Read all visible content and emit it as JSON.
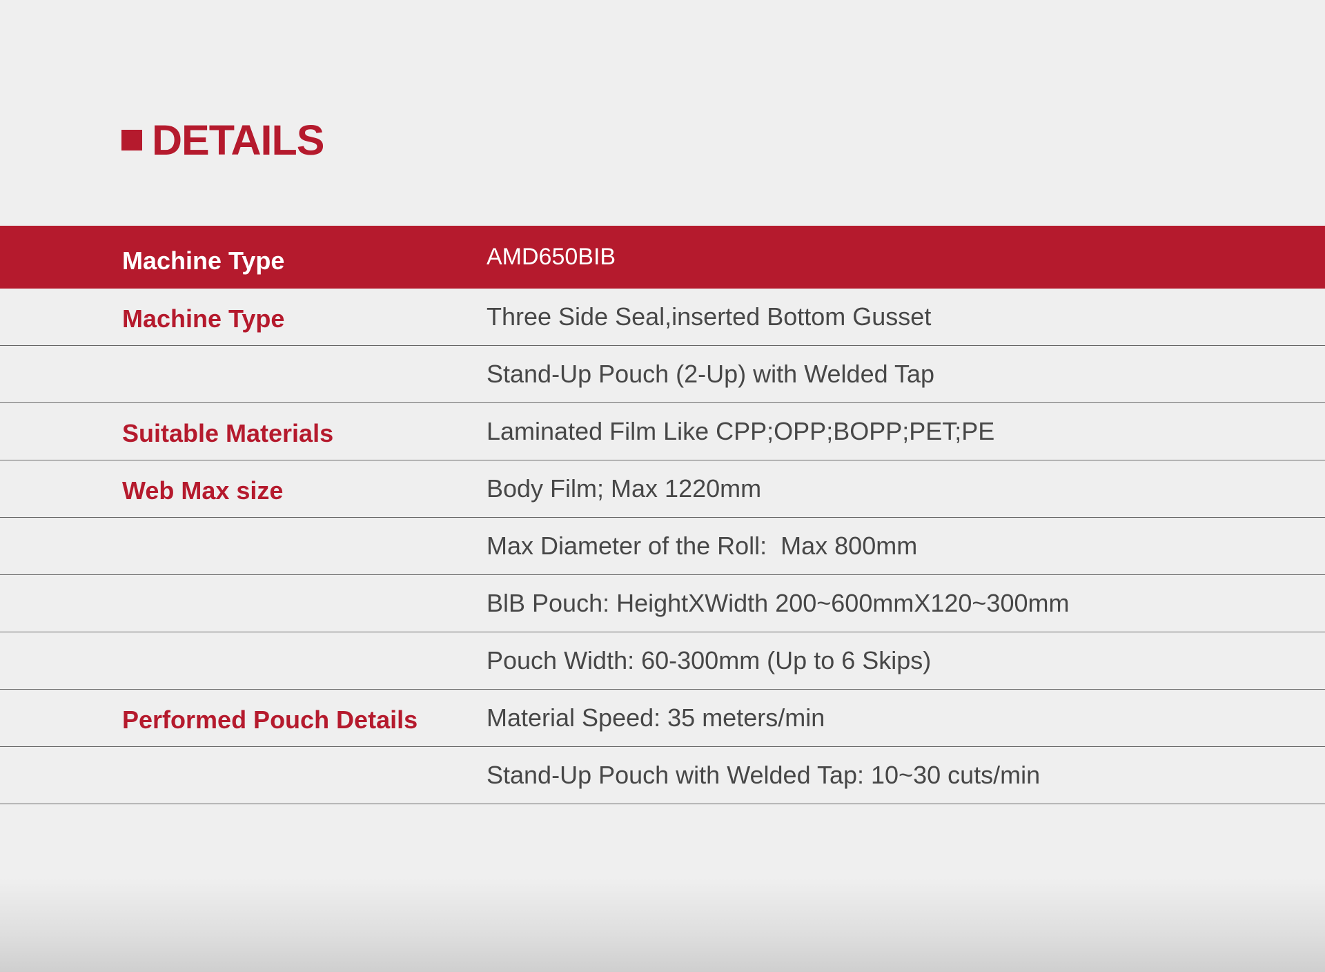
{
  "heading": {
    "title": "DETAILS"
  },
  "specs": {
    "header": {
      "label": "Machine Type",
      "value": "AMD650BIB"
    },
    "rows": [
      {
        "label": "Machine Type",
        "value": "Three Side Seal,inserted Bottom Gusset"
      },
      {
        "label": "",
        "value": "Stand-Up Pouch (2-Up) with Welded Tap"
      },
      {
        "label": "Suitable Materials",
        "value": "Laminated Film Like CPP;OPP;BOPP;PET;PE"
      },
      {
        "label": "Web Max size",
        "value": "Body Film; Max 1220mm"
      },
      {
        "label": "",
        "value": "Max Diameter of the Roll:  Max 800mm"
      },
      {
        "label": "",
        "value": "BlB Pouch: HeightXWidth 200~600mmX120~300mm"
      },
      {
        "label": "",
        "value": "Pouch Width: 60-300mm (Up to 6 Skips)"
      },
      {
        "label": "Performed Pouch Details",
        "value": "Material Speed: 35 meters/min"
      },
      {
        "label": "",
        "value": "Stand-Up Pouch with Welded Tap: 10~30 cuts/min"
      }
    ]
  },
  "colors": {
    "accent": "#b51a2d",
    "background": "#efefef",
    "value_text": "#474747",
    "divider": "#666666"
  }
}
